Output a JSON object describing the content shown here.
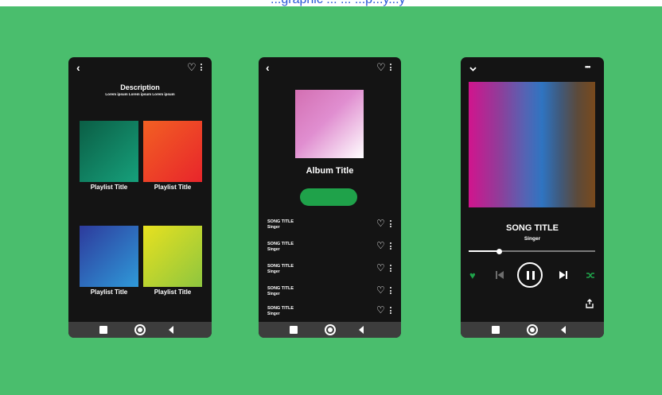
{
  "banner": {
    "text": "...graphic ... ... ...p...y...y"
  },
  "colors": {
    "background": "#4abe6d",
    "accent_green": "#1fa24a",
    "phone": "#141414"
  },
  "screen_playlists": {
    "description_title": "Description",
    "description_sub": "Lorem ipsum  Lorem ipsum  Lorem ipsum",
    "playlists": [
      {
        "label": "Playlist Title",
        "colors": [
          "#0b5e45",
          "#16a07b"
        ]
      },
      {
        "label": "Playlist Title",
        "colors": [
          "#f26023",
          "#e8252b"
        ]
      },
      {
        "label": "Playlist Title",
        "colors": [
          "#2d3a9c",
          "#2f9ad9"
        ]
      },
      {
        "label": "Playlist Title",
        "colors": [
          "#e8e11f",
          "#8ec63f"
        ]
      }
    ]
  },
  "screen_album": {
    "album_title": "Album Title",
    "songs": [
      {
        "title": "SONG TITLE",
        "singer": "Singer"
      },
      {
        "title": "SONG TITLE",
        "singer": "Singer"
      },
      {
        "title": "SONG TITLE",
        "singer": "Singer"
      },
      {
        "title": "SONG TITLE",
        "singer": "Singer"
      },
      {
        "title": "SONG TITLE",
        "singer": "Singer"
      }
    ]
  },
  "screen_player": {
    "song_title": "SONG TITLE",
    "singer": "Singer",
    "progress": 0.24,
    "menu_icon": "•••"
  },
  "icons": {
    "back": "‹",
    "heart": "♡",
    "heart_filled": "♥"
  }
}
